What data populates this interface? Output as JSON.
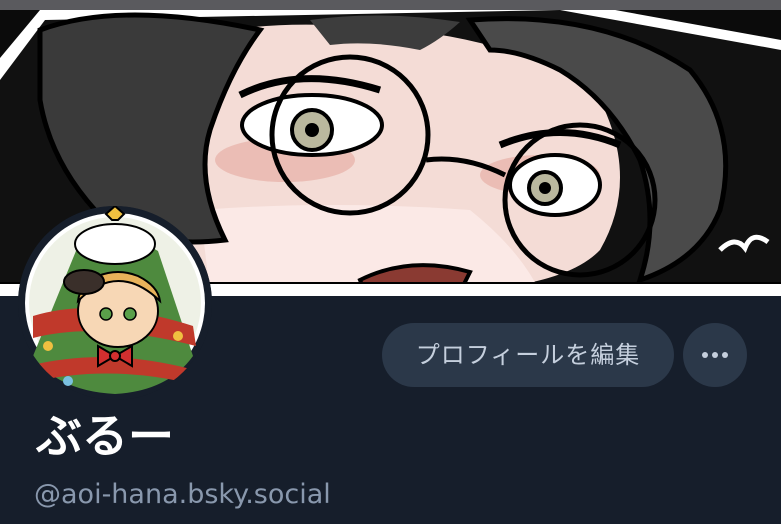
{
  "profile": {
    "display_name": "ぶるー",
    "handle": "@aoi-hana.bsky.social",
    "edit_profile_label": "プロフィールを編集"
  },
  "icons": {
    "more": "more-horizontal-icon"
  },
  "colors": {
    "background": "#161e2b",
    "button_background": "#2b3849",
    "button_text": "#c5cfdd",
    "display_name": "#ffffff",
    "handle": "#8998ad"
  }
}
